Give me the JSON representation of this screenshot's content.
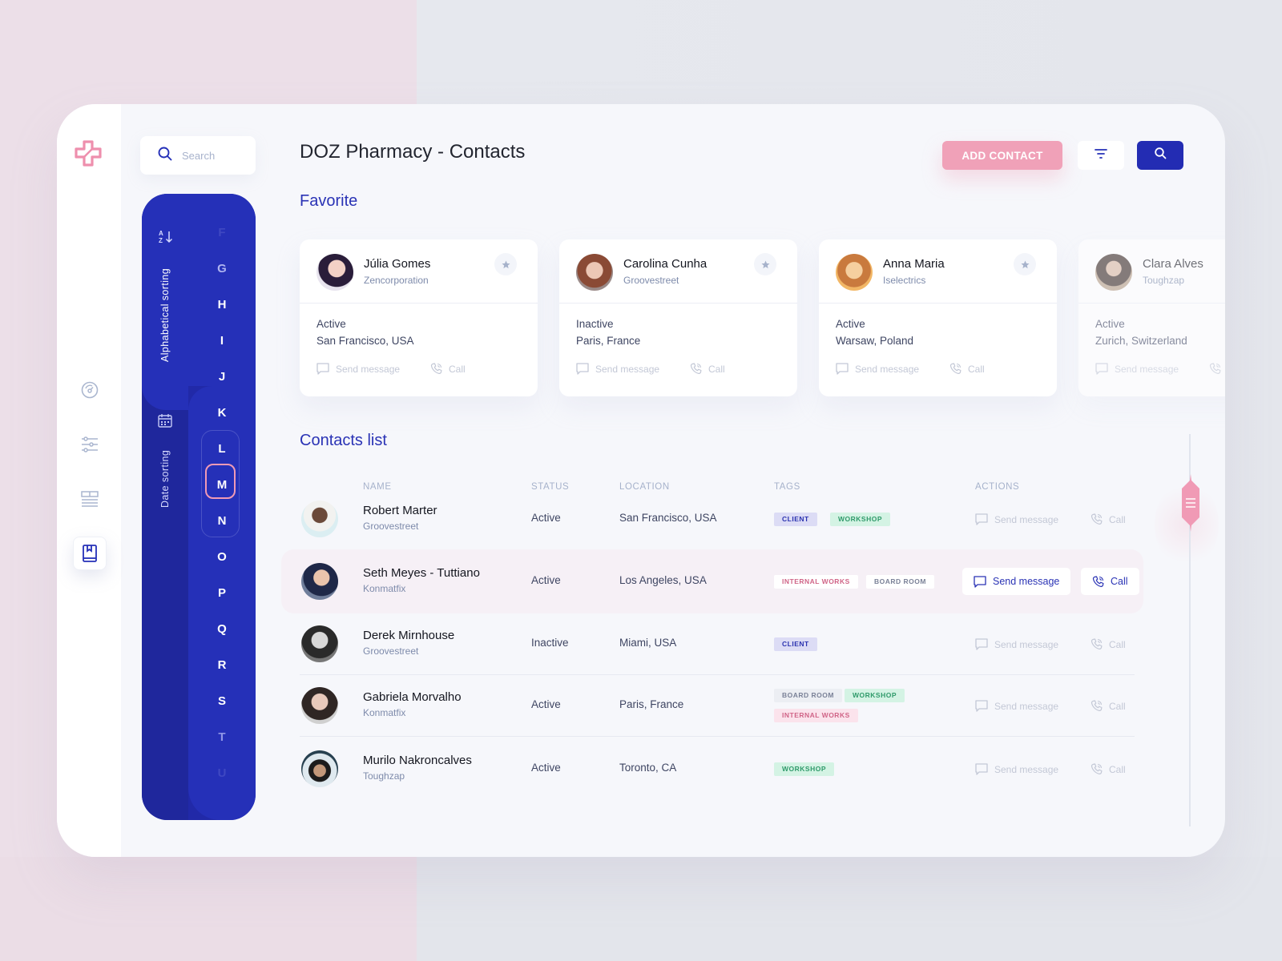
{
  "app": {
    "title": "DOZ Pharmacy - Contacts",
    "brand_color": "#2530b8",
    "accent_color": "#f0a1b8"
  },
  "rail": {
    "items": [
      {
        "icon": "dashboard-gauge-icon",
        "label": "Dashboard"
      },
      {
        "icon": "sliders-icon",
        "label": "Settings"
      },
      {
        "icon": "list-layout-icon",
        "label": "Layout"
      },
      {
        "icon": "contacts-book-icon",
        "label": "Contacts",
        "active": true
      }
    ]
  },
  "search": {
    "placeholder": "Search",
    "value": ""
  },
  "sorting": {
    "alphabetical_label": "Alphabetical sorting",
    "date_label": "Date sorting",
    "letters": [
      "F",
      "G",
      "H",
      "I",
      "J",
      "K",
      "L",
      "M",
      "N",
      "O",
      "P",
      "Q",
      "R",
      "S",
      "T",
      "U"
    ],
    "selected_letter": "M",
    "group": [
      "L",
      "M",
      "N"
    ]
  },
  "toolbar": {
    "add_contact_label": "ADD CONTACT",
    "filter_icon": "filter-icon",
    "search_icon": "search-icon"
  },
  "favorites": {
    "title": "Favorite",
    "cards": [
      {
        "name": "Júlia Gomes",
        "company": "Zencorporation",
        "status": "Active",
        "location": "San Francisco, USA",
        "message_label": "Send message",
        "call_label": "Call"
      },
      {
        "name": "Carolina Cunha",
        "company": "Groovestreet",
        "status": "Inactive",
        "location": "Paris, France",
        "message_label": "Send message",
        "call_label": "Call"
      },
      {
        "name": "Anna Maria",
        "company": "Iselectrics",
        "status": "Active",
        "location": "Warsaw, Poland",
        "message_label": "Send message",
        "call_label": "Call"
      },
      {
        "name": "Clara Alves",
        "company": "Toughzap",
        "status": "Active",
        "location": "Zurich, Switzerland",
        "message_label": "Send message",
        "call_label": "Call"
      }
    ]
  },
  "contacts": {
    "title": "Contacts list",
    "columns": [
      "NAME",
      "STATUS",
      "LOCATION",
      "TAGS",
      "ACTIONS"
    ],
    "rows": [
      {
        "name": "Robert Marter",
        "company": "Groovestreet",
        "status": "Active",
        "location": "San Francisco, USA",
        "tags": [
          "CLIENT",
          "WORKSHOP"
        ],
        "message_label": "Send message",
        "call_label": "Call"
      },
      {
        "name": "Seth Meyes - Tuttiano",
        "company": "Konmatfix",
        "status": "Active",
        "location": "Los Angeles, USA",
        "tags": [
          "INTERNAL WORKS",
          "BOARD ROOM"
        ],
        "message_label": "Send message",
        "call_label": "Call",
        "highlighted": true
      },
      {
        "name": "Derek Mirnhouse",
        "company": "Groovestreet",
        "status": "Inactive",
        "location": "Miami, USA",
        "tags": [
          "CLIENT"
        ],
        "message_label": "Send message",
        "call_label": "Call"
      },
      {
        "name": "Gabriela Morvalho",
        "company": "Konmatfix",
        "status": "Active",
        "location": "Paris, France",
        "tags": [
          "BOARD ROOM",
          "WORKSHOP",
          "INTERNAL WORKS"
        ],
        "message_label": "Send message",
        "call_label": "Call"
      },
      {
        "name": "Murilo Nakroncalves",
        "company": "Toughzap",
        "status": "Active",
        "location": "Toronto, CA",
        "tags": [
          "WORKSHOP"
        ],
        "message_label": "Send message",
        "call_label": "Call"
      }
    ]
  },
  "scrollbar": {
    "position_fraction": 0.12
  }
}
